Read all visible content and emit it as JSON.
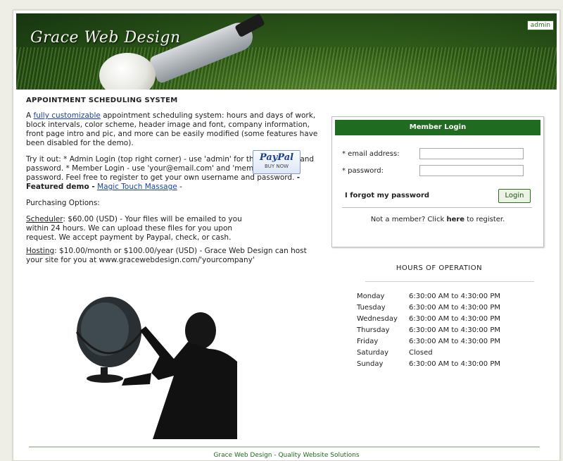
{
  "header": {
    "title": "Grace Web Design",
    "admin_label": "admin"
  },
  "left": {
    "heading": "APPOINTMENT SCHEDULING SYSTEM",
    "intro_prefix": "A",
    "intro_link": "fully customizable",
    "intro_rest": "appointment scheduling system: hours and days of work, block intervals, color scheme, header image and font, company information, front page intro and pic, and more can be easily modified (some features have been disabled for the demo).",
    "tryit_text": "Try it out: * Admin Login (top right corner) - use 'admin' for the username and password. * Member Login - use 'your@email.com' and 'member' for the password. Feel free to register to get your own username and password.",
    "featured_label": "- Featured demo -",
    "featured_link": "Magic Touch Massage",
    "featured_suffix": "-",
    "purchasing": "Purchasing Options:",
    "scheduler_label": "Scheduler",
    "scheduler_text": ": $60.00 (USD) - Your files will be emailed to you within 24 hours. We can upload these files for you upon request. We accept payment by Paypal, check, or cash.",
    "hosting_label": "Hosting",
    "hosting_text": ": $10.00/month or $100.00/year (USD) - Grace Web Design can host your site for you at www.gracewebdesign.com/'yourcompany'",
    "paypal_logo": "PayPal",
    "paypal_sub": "BUY NOW"
  },
  "login": {
    "title": "Member Login",
    "email_label": "* email address:",
    "email_value": "",
    "password_label": "* password:",
    "password_value": "",
    "forgot": "I forgot my password",
    "button": "Login",
    "register_prefix": "Not a member? Click",
    "register_link": "here",
    "register_suffix": "to register."
  },
  "hours": {
    "title": "HOURS OF OPERATION",
    "rows": [
      {
        "day": "Monday",
        "time": "6:30:00 AM to 4:30:00 PM"
      },
      {
        "day": "Tuesday",
        "time": "6:30:00 AM to 4:30:00 PM"
      },
      {
        "day": "Wednesday",
        "time": "6:30:00 AM to 4:30:00 PM"
      },
      {
        "day": "Thursday",
        "time": "6:30:00 AM to 4:30:00 PM"
      },
      {
        "day": "Friday",
        "time": "6:30:00 AM to 4:30:00 PM"
      },
      {
        "day": "Saturday",
        "time": "Closed"
      },
      {
        "day": "Sunday",
        "time": "6:30:00 AM to 4:30:00 PM"
      }
    ]
  },
  "footer": {
    "text": "Grace Web Design - Quality Website Solutions"
  },
  "colors": {
    "brand_green": "#1f6b1f",
    "link_blue": "#1a44a8"
  }
}
